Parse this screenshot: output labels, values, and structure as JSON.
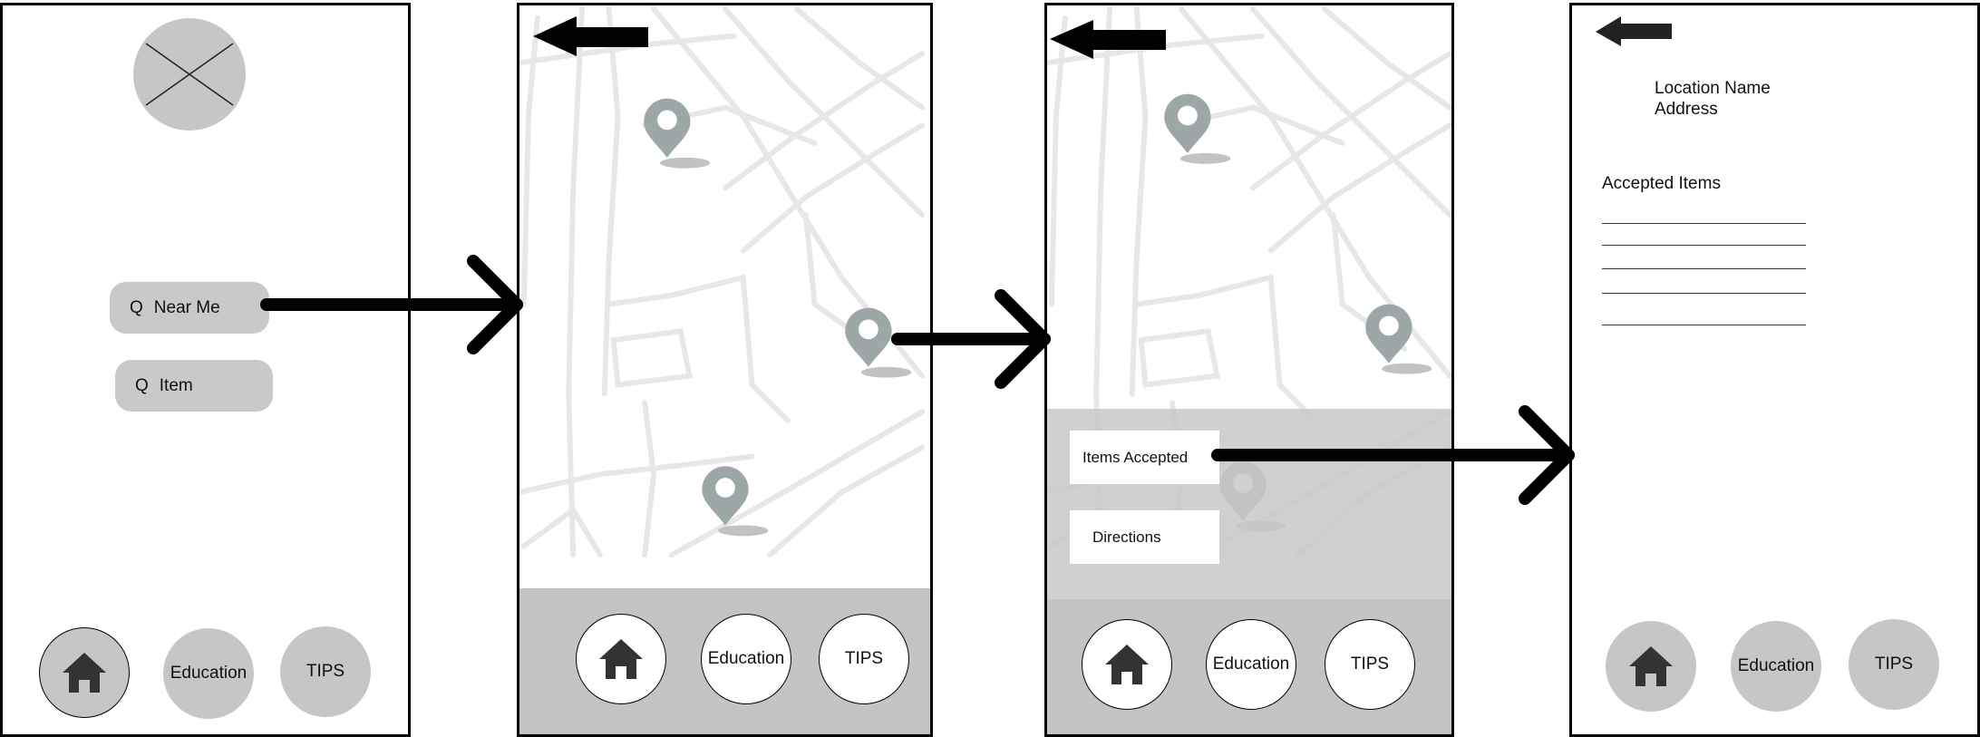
{
  "screen1": {
    "search_near_me": {
      "q": "Q",
      "label": "Near Me"
    },
    "search_item": {
      "q": "Q",
      "label": "Item"
    },
    "nav": {
      "education": "Education",
      "tips": "TIPS"
    }
  },
  "screen2": {
    "nav": {
      "education": "Education",
      "tips": "TIPS"
    }
  },
  "screen3": {
    "items_accepted": "Items Accepted",
    "directions": "Directions",
    "nav": {
      "education": "Education",
      "tips": "TIPS"
    }
  },
  "screen4": {
    "location_name": "Location Name",
    "address": "Address",
    "accepted_items": "Accepted Items",
    "nav": {
      "education": "Education",
      "tips": "TIPS"
    }
  },
  "colors": {
    "panel_gray": "#c4c4c4",
    "pin": "#9ea7a7",
    "pill": "#c9c9c9"
  },
  "icons": [
    "image-placeholder-icon",
    "back-arrow-icon",
    "home-icon",
    "map-pin-icon",
    "flow-arrow-icon"
  ]
}
